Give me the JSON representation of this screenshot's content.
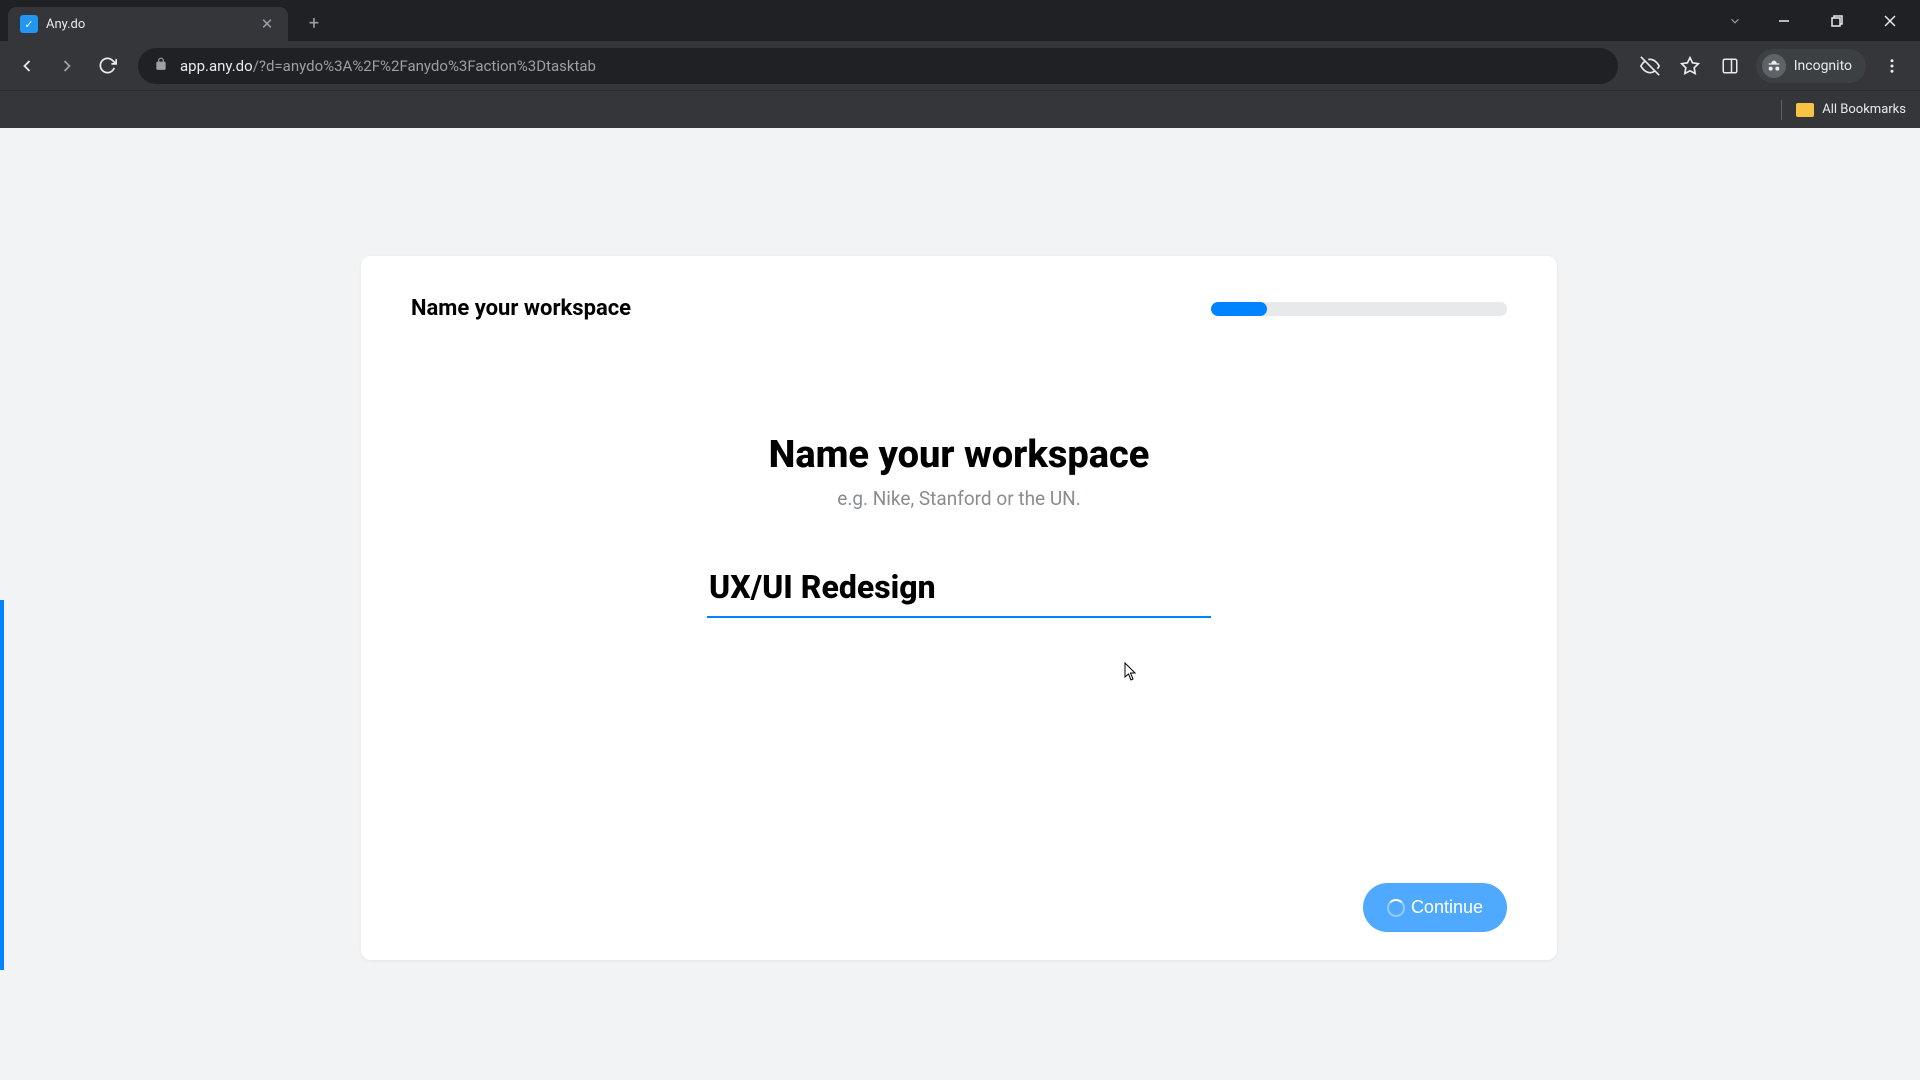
{
  "browser": {
    "tab_title": "Any.do",
    "url_domain": "app.any.do",
    "url_path": "/?d=anydo%3A%2F%2Fanydo%3Faction%3Dtasktab",
    "incognito_label": "Incognito",
    "bookmarks_label": "All Bookmarks"
  },
  "card": {
    "header_title": "Name your workspace",
    "progress_percent": 19,
    "main_heading": "Name your workspace",
    "subtitle": "e.g. Nike, Stanford or the UN.",
    "input_value": "UX/UI Redesign",
    "continue_label": "Continue"
  }
}
